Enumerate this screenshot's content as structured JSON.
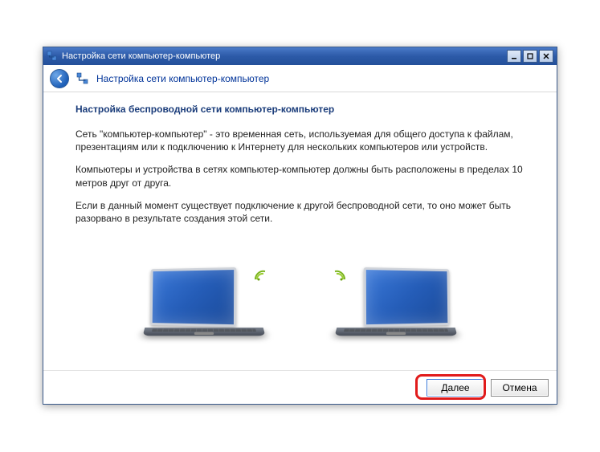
{
  "window": {
    "title": "Настройка сети компьютер-компьютер"
  },
  "header": {
    "breadcrumb": "Настройка сети компьютер-компьютер"
  },
  "content": {
    "heading": "Настройка беспроводной сети компьютер-компьютер",
    "paragraph1": "Сеть \"компьютер-компьютер\" - это временная сеть, используемая для общего доступа к файлам, презентациям или к подключению к Интернету для нескольких компьютеров или устройств.",
    "paragraph2": "Компьютеры и устройства в сетях компьютер-компьютер должны быть расположены в пределах 10 метров друг от друга.",
    "paragraph3": "Если в данный момент существует подключение к другой беспроводной сети, то оно может быть разорвано в результате создания этой сети."
  },
  "buttons": {
    "next": "Далее",
    "cancel": "Отмена"
  }
}
